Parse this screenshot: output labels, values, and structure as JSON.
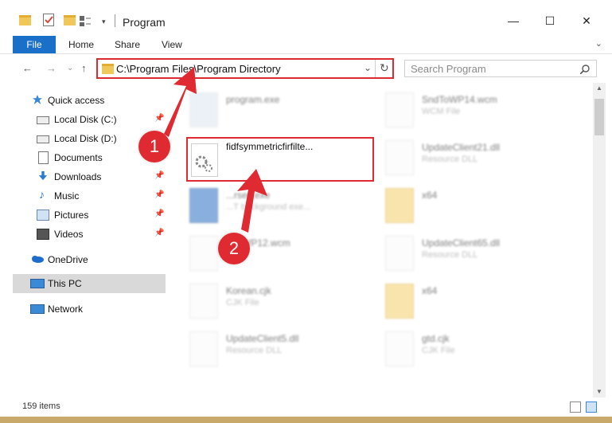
{
  "window": {
    "title": "Program"
  },
  "controls": {
    "minimize": "—",
    "maximize": "☐",
    "close": "✕"
  },
  "ribbon": {
    "tabs": [
      "File",
      "Home",
      "Share",
      "View"
    ],
    "expand": "⌄"
  },
  "address": {
    "path": "C:\\Program Files\\Program Directory",
    "dropdown": "⌄",
    "refresh": "↻"
  },
  "search": {
    "placeholder": "Search Program",
    "icon": "search-icon"
  },
  "nav": {
    "back": "←",
    "forward": "→",
    "recent": "⌄",
    "up": "↑"
  },
  "sidebar": {
    "items": [
      {
        "label": "Quick access",
        "icon": "star-icon",
        "pinned": false
      },
      {
        "label": "Local Disk (C:)",
        "icon": "drive-icon",
        "pinned": true
      },
      {
        "label": "Local Disk (D:)",
        "icon": "drive-icon",
        "pinned": false
      },
      {
        "label": "Documents",
        "icon": "documents-icon",
        "pinned": true
      },
      {
        "label": "Downloads",
        "icon": "download-icon",
        "pinned": true
      },
      {
        "label": "Music",
        "icon": "music-icon",
        "pinned": true
      },
      {
        "label": "Pictures",
        "icon": "pictures-icon",
        "pinned": true
      },
      {
        "label": "Videos",
        "icon": "videos-icon",
        "pinned": true
      },
      {
        "label": "OneDrive",
        "icon": "cloud-icon",
        "pinned": false
      },
      {
        "label": "This PC",
        "icon": "computer-icon",
        "pinned": false,
        "selected": true
      },
      {
        "label": "Network",
        "icon": "network-icon",
        "pinned": false
      }
    ]
  },
  "files": [
    {
      "name": "program.exe",
      "type": ""
    },
    {
      "name": "SndToWP14.wcm",
      "type": "WCM File"
    },
    {
      "name": "fidfsymmetricfirfilte...",
      "type": "",
      "highlighted": true
    },
    {
      "name": "UpdateClient21.dll",
      "type": "Resource DLL"
    },
    {
      "name": "...rsec.exe",
      "type": "...T background exe..."
    },
    {
      "name": "x64",
      "type": ""
    },
    {
      "name": "...toWP12.wcm",
      "type": "...File"
    },
    {
      "name": "UpdateClient65.dll",
      "type": "Resource DLL"
    },
    {
      "name": "Korean.cjk",
      "type": "CJK File"
    },
    {
      "name": "x64",
      "type": ""
    },
    {
      "name": "UpdateClient5.dll",
      "type": "Resource DLL"
    },
    {
      "name": "gtd.cjk",
      "type": "CJK File"
    }
  ],
  "markers": [
    "1",
    "2"
  ],
  "status": {
    "count": "159 items"
  },
  "colors": {
    "accent": "#1a6fc8",
    "highlight": "#e02a31"
  }
}
